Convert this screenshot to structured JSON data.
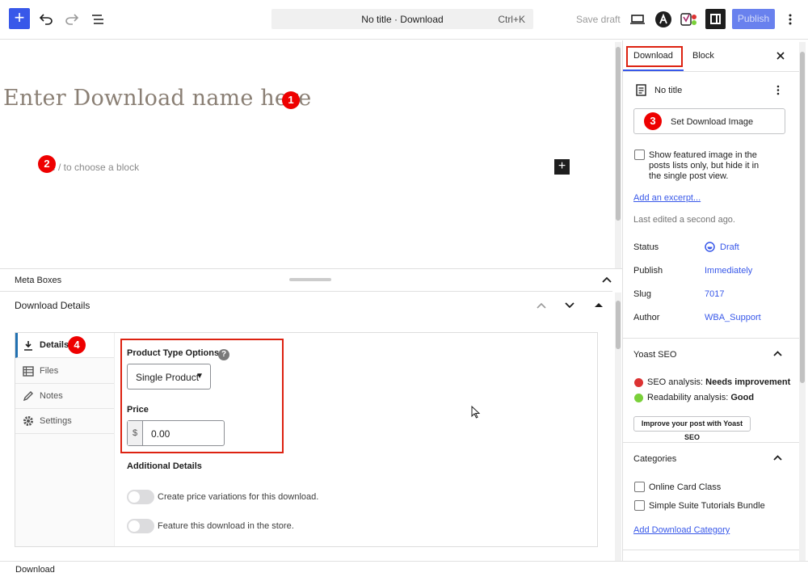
{
  "topbar": {
    "add_label": "+",
    "command_title": "No title · Download",
    "command_shortcut": "Ctrl+K",
    "save_draft": "Save draft",
    "publish": "Publish",
    "icons": [
      "undo-icon",
      "redo-icon",
      "list-view-icon",
      "preview-device-icon",
      "astra-logo-icon",
      "yoast-icon",
      "settings-sidebar-icon",
      "more-vertical-icon"
    ]
  },
  "editor": {
    "title_placeholder": "Enter Download name here",
    "block_placeholder": "Type / to choose a block",
    "block_placeholder_visible": "e / to choose a block",
    "badges": [
      "1",
      "2",
      "3",
      "4"
    ]
  },
  "meta": {
    "header": "Meta Boxes",
    "box_title": "Download Details",
    "tabs": [
      {
        "label": "Details",
        "icon": "download-icon"
      },
      {
        "label": "Files",
        "icon": "files-icon"
      },
      {
        "label": "Notes",
        "icon": "pen-icon"
      },
      {
        "label": "Settings",
        "icon": "gear-icon"
      }
    ],
    "product_type_label": "Product Type Options:",
    "help": "?",
    "product_type_value": "Single Product",
    "price_label": "Price",
    "currency": "$",
    "price_value": "0.00",
    "additional_details": "Additional Details",
    "toggles": [
      "Create price variations for this download.",
      "Feature this download in the store."
    ]
  },
  "footer": {
    "breadcrumb": "Download"
  },
  "sidebar": {
    "tabs": [
      "Download",
      "Block"
    ],
    "post_title": "No title",
    "set_image": "Set Download Image",
    "featured_option": [
      "Show featured image in the",
      "posts lists only, but hide it in",
      "the single post view."
    ],
    "add_excerpt": "Add an excerpt...",
    "last_edited": "Last edited a second ago.",
    "rows": [
      {
        "label": "Status",
        "value": "Draft"
      },
      {
        "label": "Publish",
        "value": "Immediately"
      },
      {
        "label": "Slug",
        "value": "7017"
      },
      {
        "label": "Author",
        "value": "WBA_Support"
      }
    ],
    "yoast": {
      "title": "Yoast SEO",
      "seo_label": "SEO analysis: ",
      "seo_value": "Needs improvement",
      "read_label": "Readability analysis: ",
      "read_value": "Good",
      "button": "Improve your post with Yoast SEO"
    },
    "categories": {
      "title": "Categories",
      "items": [
        "Online Card Class",
        "Simple Suite Tutorials Bundle"
      ],
      "add_link": "Add Download Category"
    },
    "colors": {
      "accent": "#3858e9",
      "seo_bad": "#dc3232",
      "seo_good": "#7ad03a",
      "annotation": "#e00000"
    }
  }
}
